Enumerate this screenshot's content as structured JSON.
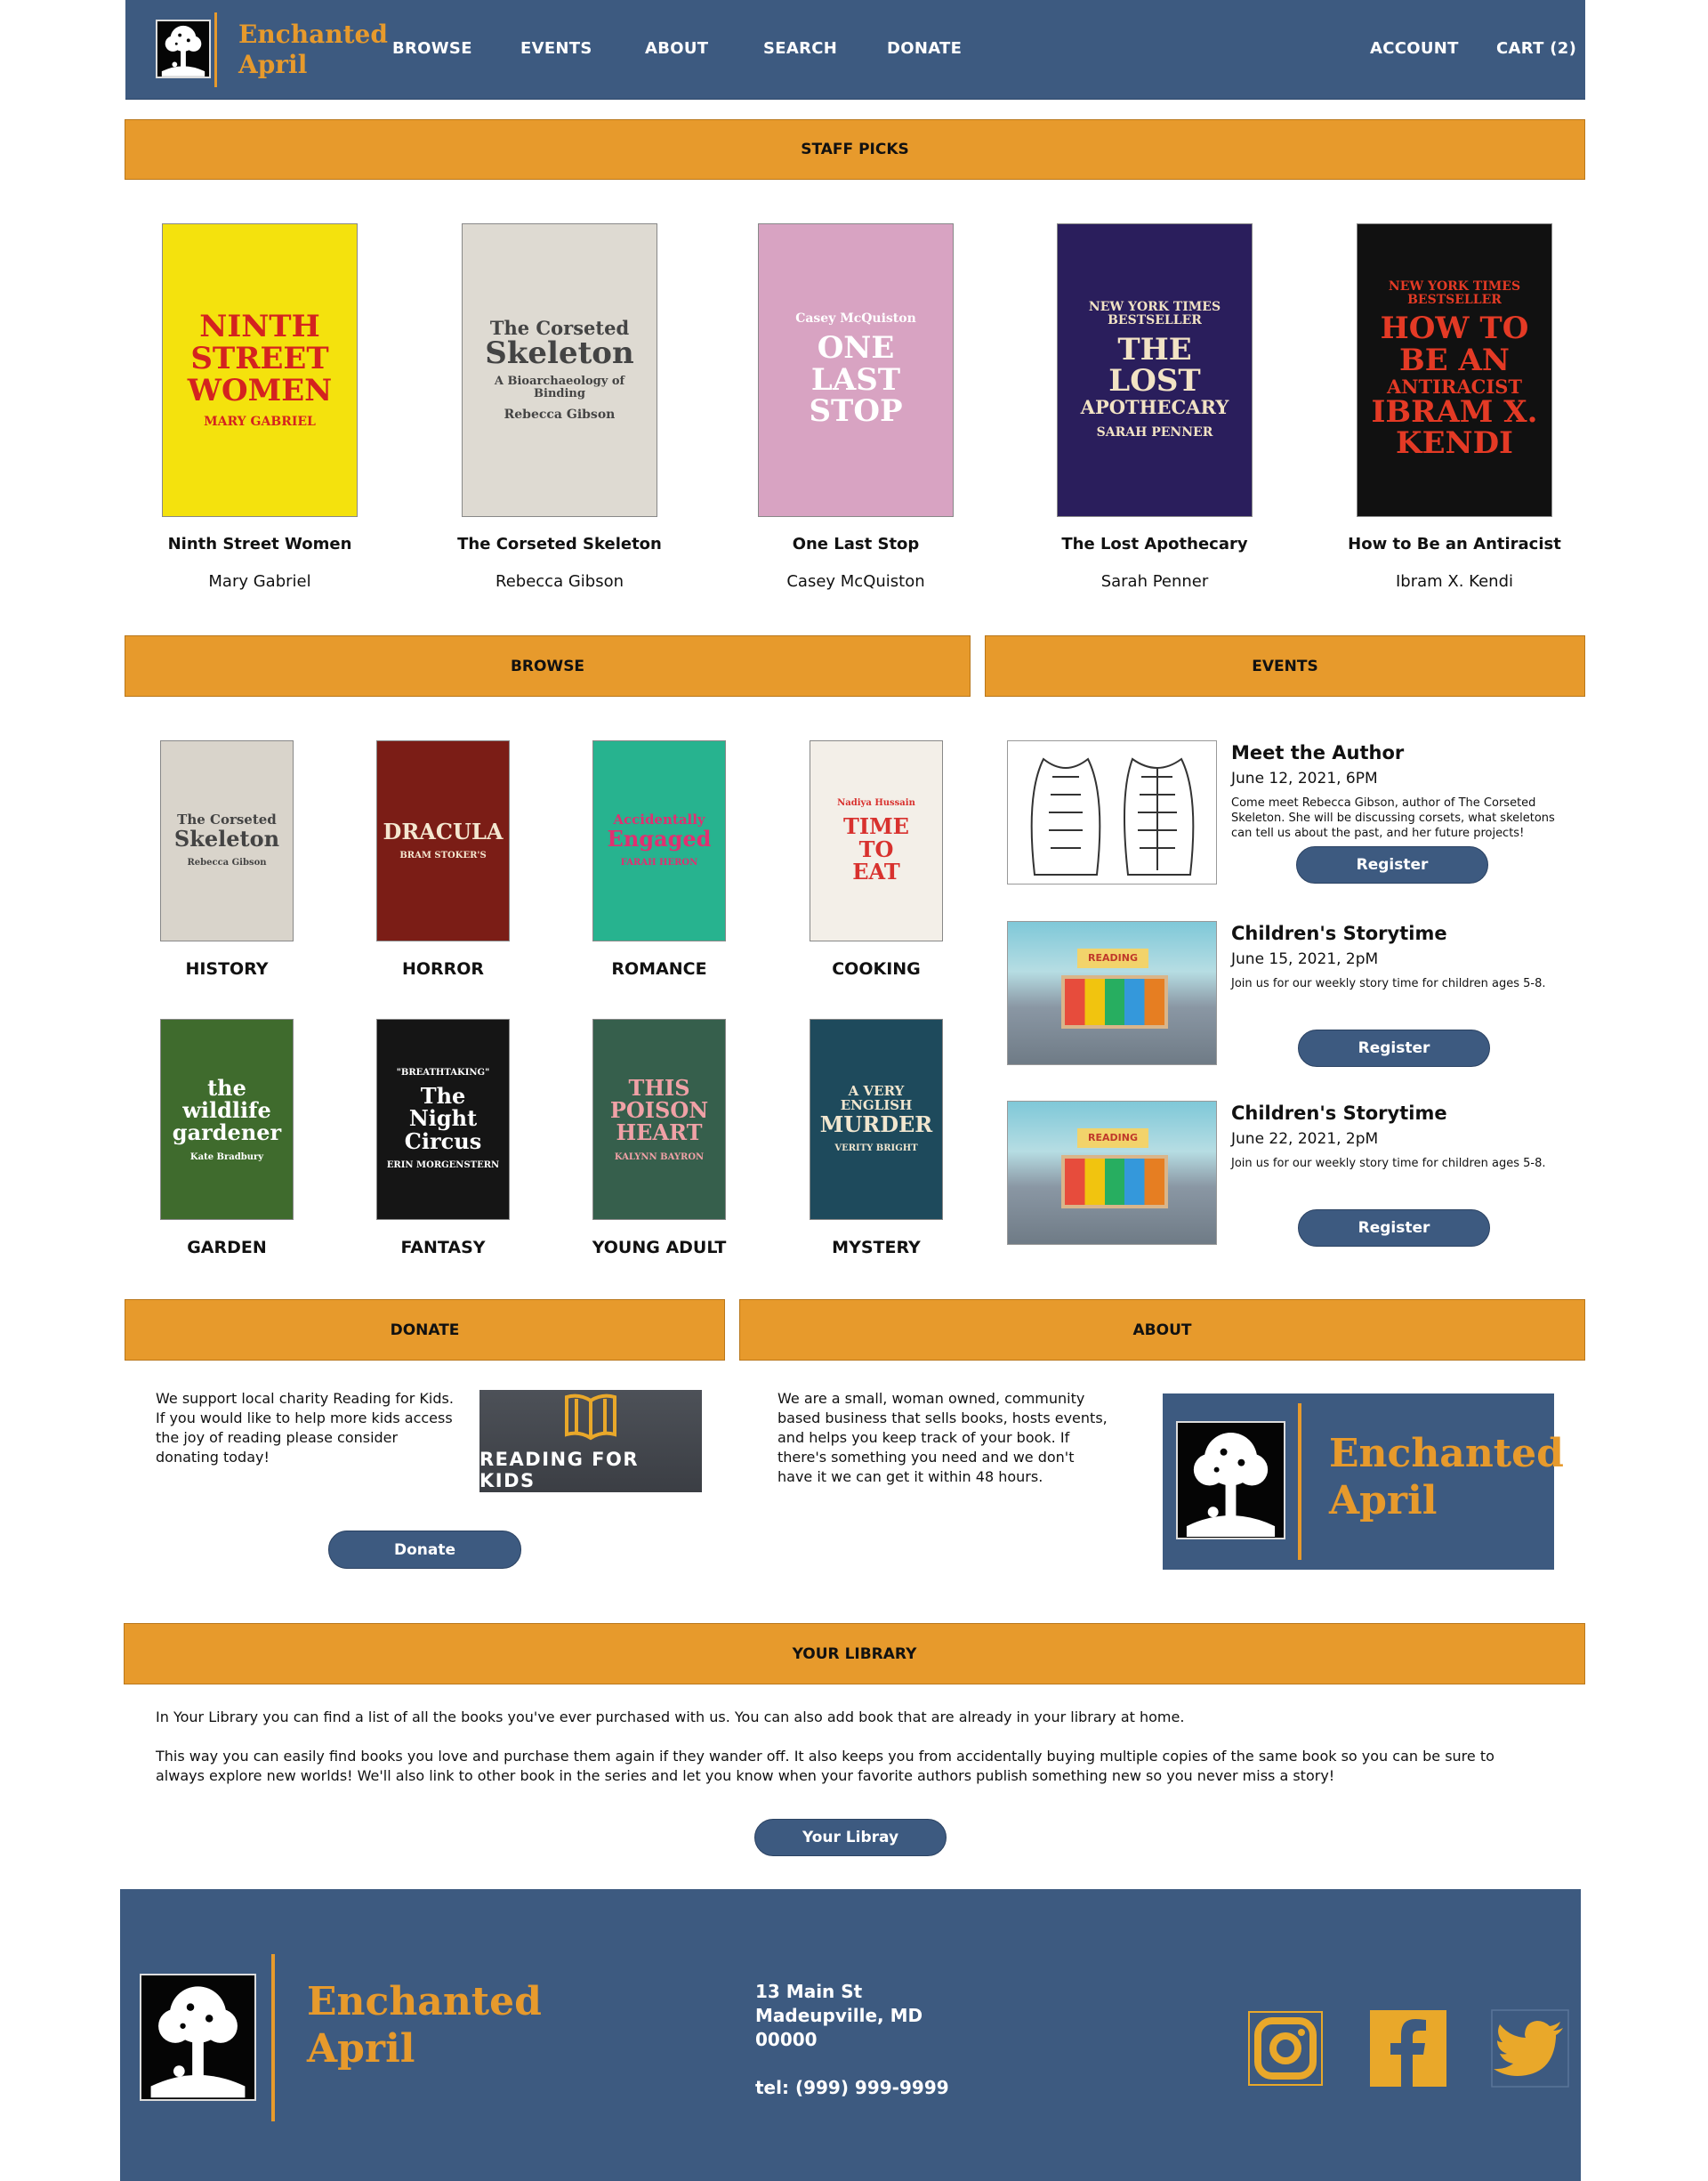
{
  "brand": {
    "line1": "Enchanted",
    "line2": "April"
  },
  "nav": {
    "items": [
      "BROWSE",
      "EVENTS",
      "ABOUT",
      "SEARCH",
      "DONATE"
    ],
    "account": "ACCOUNT",
    "cart": "CART (2)"
  },
  "staff_picks": {
    "heading": "STAFF PICKS",
    "books": [
      {
        "title": "Ninth Street Women",
        "author": "Mary Gabriel",
        "cover_lines": [
          "NINTH",
          "STREET",
          "WOMEN"
        ],
        "cover_author": "MARY GABRIEL",
        "bg": "#f4e20d",
        "fg": "#d4231f"
      },
      {
        "title": "The Corseted Skeleton",
        "author": "Rebecca Gibson",
        "cover_lines": [
          "The Corseted",
          "Skeleton"
        ],
        "cover_sub": "A Bioarchaeology of Binding",
        "cover_author": "Rebecca Gibson",
        "bg": "#dedad2",
        "fg": "#444444"
      },
      {
        "title": "One Last Stop",
        "author": "Casey McQuiston",
        "cover_lines": [
          "ONE",
          "LAST",
          "STOP"
        ],
        "cover_top": "Casey McQuiston",
        "bg": "#d8a3c2",
        "fg": "#ffffff"
      },
      {
        "title": "The Lost Apothecary",
        "author": "Sarah Penner",
        "cover_lines": [
          "THE",
          "LOST",
          "APOTHECARY"
        ],
        "cover_top": "NEW YORK TIMES BESTSELLER",
        "cover_author": "SARAH PENNER",
        "bg": "#2a1e5c",
        "fg": "#f2e3c4"
      },
      {
        "title": "How to Be an Antiracist",
        "author": "Ibram X. Kendi",
        "cover_lines": [
          "HOW TO",
          "BE AN",
          "ANTIRACIST",
          "IBRAM X.",
          "KENDI"
        ],
        "cover_top": "NEW YORK TIMES BESTSELLER",
        "bg": "#111111",
        "fg": "#e43a25"
      }
    ]
  },
  "browse": {
    "heading": "BROWSE",
    "genres": [
      {
        "label": "HISTORY",
        "cover_lines": [
          "The Corseted",
          "Skeleton"
        ],
        "cover_author": "Rebecca Gibson",
        "bg": "#d9d4cb",
        "fg": "#444444"
      },
      {
        "label": "HORROR",
        "cover_lines": [
          "DRACULA"
        ],
        "cover_author": "BRAM STOKER'S",
        "bg": "#7b1d16",
        "fg": "#f4e7d0"
      },
      {
        "label": "ROMANCE",
        "cover_lines": [
          "Accidentally",
          "Engaged"
        ],
        "cover_author": "FARAH HERON",
        "bg": "#27b38f",
        "fg": "#e12f71"
      },
      {
        "label": "COOKING",
        "cover_lines": [
          "TIME",
          "TO",
          "EAT"
        ],
        "cover_top": "Nadiya Hussain",
        "bg": "#f3efe8",
        "fg": "#d8312e"
      },
      {
        "label": "GARDEN",
        "cover_lines": [
          "the",
          "wildlife",
          "gardener"
        ],
        "cover_author": "Kate Bradbury",
        "bg": "#3f6b2d",
        "fg": "#ffffff"
      },
      {
        "label": "FANTASY",
        "cover_lines": [
          "The",
          "Night",
          "Circus"
        ],
        "cover_top": "\"BREATHTAKING\"",
        "cover_author": "ERIN MORGENSTERN",
        "bg": "#151515",
        "fg": "#ffffff"
      },
      {
        "label": "YOUNG ADULT",
        "cover_lines": [
          "THIS",
          "POISON",
          "HEART"
        ],
        "cover_author": "KALYNN BAYRON",
        "bg": "#365f4c",
        "fg": "#f0a1a6"
      },
      {
        "label": "MYSTERY",
        "cover_lines": [
          "A VERY ENGLISH",
          "MURDER"
        ],
        "cover_author": "VERITY BRIGHT",
        "bg": "#1e4a5c",
        "fg": "#f1e6cf"
      }
    ]
  },
  "events": {
    "heading": "EVENTS",
    "items": [
      {
        "title": "Meet the Author",
        "date": "June 12, 2021, 6PM",
        "desc": "Come meet Rebecca Gibson, author of The Corseted Skeleton. She will be discussing corsets, what skeletons can tell us about the past, and her future projects!",
        "button": "Register"
      },
      {
        "title": "Children's Storytime",
        "date": "June 15, 2021, 2pM",
        "desc": "Join us for our weekly story time for children ages 5-8.",
        "button": "Register"
      },
      {
        "title": "Children's Storytime",
        "date": "June 22, 2021, 2pM",
        "desc": "Join us for our weekly story time for children ages 5-8.",
        "button": "Register"
      }
    ],
    "poster_text": "READING"
  },
  "donate": {
    "heading": "DONATE",
    "text": "We support local charity Reading for Kids. If you would like to help more kids access the joy of reading please consider donating today!",
    "charity_name": "READING FOR KIDS",
    "button": "Donate"
  },
  "about": {
    "heading": "ABOUT",
    "text": "We are a small, woman owned, community based business that sells books, hosts events, and helps you keep track of your book. If there's something you need and we don't have it we can get it within 48 hours."
  },
  "library": {
    "heading": "YOUR LIBRARY",
    "paragraph1": "In Your Library you can find a list of all the books you've ever purchased with us. You can also add book that are already in your library at home.",
    "paragraph2": "This way you can easily find books you love and purchase them again if they wander off. It also keeps you from accidentally buying multiple copies of the same book so you can be sure to always explore new worlds! We'll also link to other book in the series and let you know when your favorite authors publish something new so you never miss a story!",
    "button": "Your Libray"
  },
  "footer": {
    "address_line1": "13 Main St",
    "address_line2": "Madeupville, MD",
    "address_line3": "00000",
    "phone": "tel: (999) 999-9999",
    "social_icons": [
      "instagram-icon",
      "facebook-icon",
      "twitter-icon"
    ]
  },
  "colors": {
    "navy": "#3d5a80",
    "orange": "#e79a2c"
  }
}
